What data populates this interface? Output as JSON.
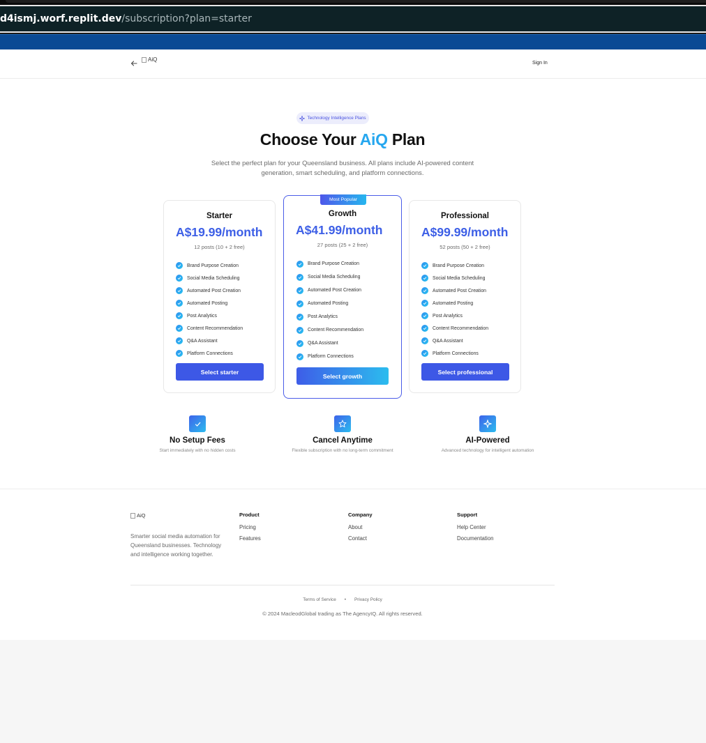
{
  "browser": {
    "url_host": "d4ismj.worf.replit.dev",
    "url_path": "/subscription?plan=starter"
  },
  "nav": {
    "logo_alt": "AiQ",
    "sign_in": "Sign In"
  },
  "hero": {
    "badge": "Technology Intelligence Plans",
    "title_pre": "Choose Your ",
    "title_accent": "AiQ",
    "title_post": " Plan",
    "subtitle": "Select the perfect plan for your Queensland business. All plans include AI-powered content generation, smart scheduling, and platform connections."
  },
  "plans": [
    {
      "name": "Starter",
      "price": "A$19.99/month",
      "posts": "12 posts (10 + 2 free)",
      "features": [
        "Brand Purpose Creation",
        "Social Media Scheduling",
        "Automated Post Creation",
        "Automated Posting",
        "Post Analytics",
        "Content Recommendation",
        "Q&A Assistant",
        "Platform Connections"
      ],
      "button": "Select starter"
    },
    {
      "name": "Growth",
      "badge": "Most Popular",
      "price": "A$41.99/month",
      "posts": "27 posts (25 + 2 free)",
      "features": [
        "Brand Purpose Creation",
        "Social Media Scheduling",
        "Automated Post Creation",
        "Automated Posting",
        "Post Analytics",
        "Content Recommendation",
        "Q&A Assistant",
        "Platform Connections"
      ],
      "button": "Select growth"
    },
    {
      "name": "Professional",
      "price": "A$99.99/month",
      "posts": "52 posts (50 + 2 free)",
      "features": [
        "Brand Purpose Creation",
        "Social Media Scheduling",
        "Automated Post Creation",
        "Automated Posting",
        "Post Analytics",
        "Content Recommendation",
        "Q&A Assistant",
        "Platform Connections"
      ],
      "button": "Select professional"
    }
  ],
  "perks": [
    {
      "icon": "check-icon",
      "title": "No Setup Fees",
      "desc": "Start immediately with no hidden costs"
    },
    {
      "icon": "star-icon",
      "title": "Cancel Anytime",
      "desc": "Flexible subscription with no long-term commitment"
    },
    {
      "icon": "sparkle-icon",
      "title": "AI-Powered",
      "desc": "Advanced technology for intelligent automation"
    }
  ],
  "footer": {
    "logo_alt": "AiQ",
    "description": "Smarter social media automation for Queensland businesses. Technology and intelligence working together.",
    "columns": [
      {
        "title": "Product",
        "links": [
          "Pricing",
          "Features"
        ]
      },
      {
        "title": "Company",
        "links": [
          "About",
          "Contact"
        ]
      },
      {
        "title": "Support",
        "links": [
          "Help Center",
          "Documentation"
        ]
      }
    ],
    "terms": "Terms of Service",
    "separator": "•",
    "privacy": "Privacy Policy",
    "copyright": "© 2024 MacleodGlobal trading as The AgencyIQ. All rights reserved."
  },
  "colors": {
    "accent_blue": "#3d5fe6",
    "accent_cyan": "#26a7ef",
    "browser_blue_bar": "#0a4a94"
  }
}
